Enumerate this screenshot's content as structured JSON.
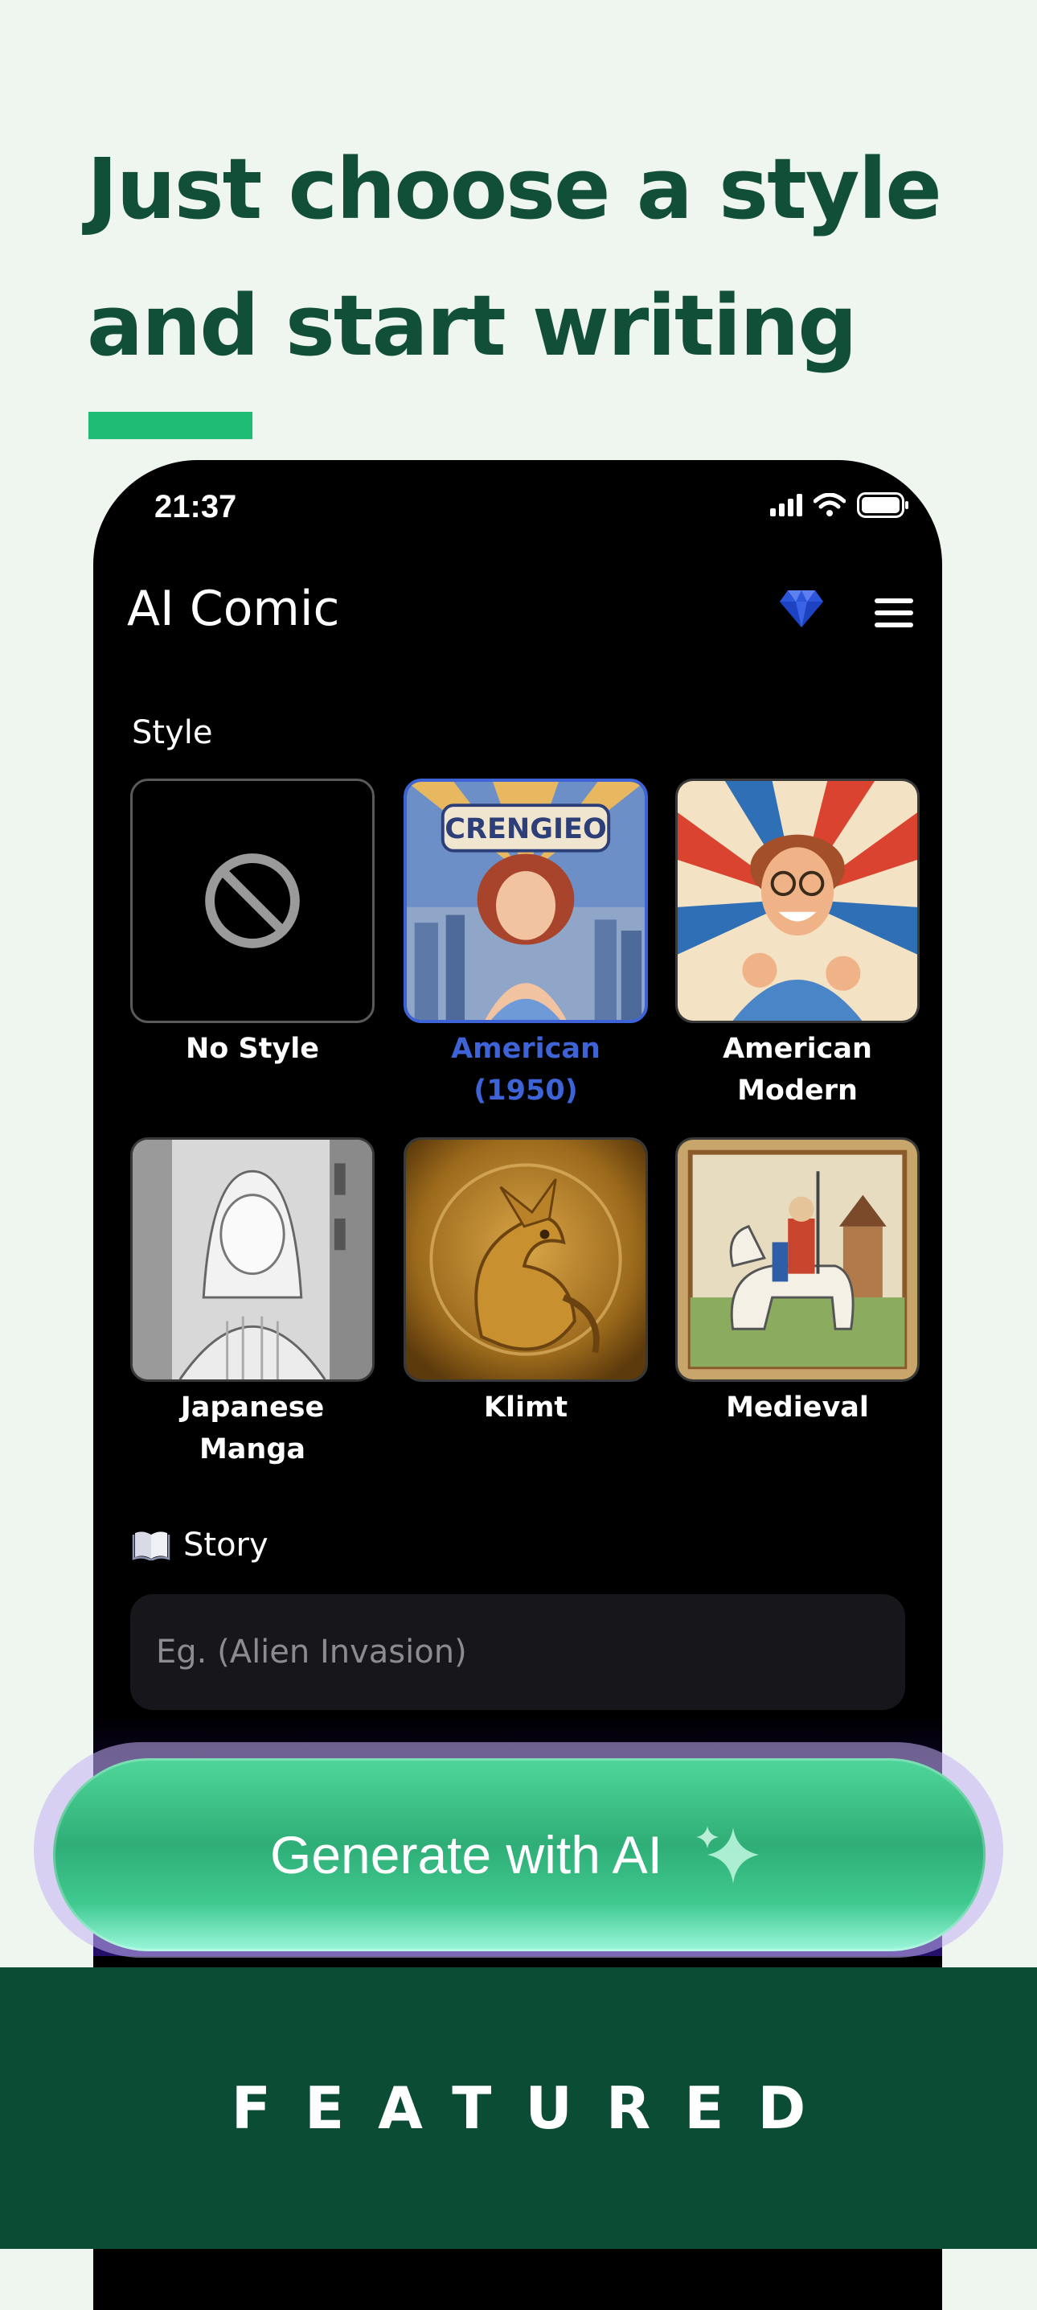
{
  "headline": {
    "line1": "Just choose a style",
    "line2": "and start writing"
  },
  "status_bar": {
    "time": "21:37",
    "icons": [
      "signal-icon",
      "wifi-icon",
      "battery-icon"
    ]
  },
  "app": {
    "title": "AI Comic",
    "premium_icon": "gem-icon",
    "menu_icon": "menu-icon"
  },
  "style_section": {
    "label": "Style",
    "styles": [
      {
        "line1": "No Style",
        "line2": "",
        "selected": false
      },
      {
        "line1": "American",
        "line2": "(1950)",
        "selected": true
      },
      {
        "line1": "American",
        "line2": "Modern",
        "selected": false
      },
      {
        "line1": "Japanese",
        "line2": "Manga",
        "selected": false
      },
      {
        "line1": "Klimt",
        "line2": "",
        "selected": false
      },
      {
        "line1": "Medieval",
        "line2": "",
        "selected": false
      }
    ],
    "thumb_text": "CRENGIEO"
  },
  "story_section": {
    "label": "Story",
    "icon": "book-icon",
    "placeholder": "Eg. (Alien Invasion)"
  },
  "generate_button": {
    "label": "Generate with AI",
    "icon": "sparkle-icon"
  },
  "footer": {
    "label": "FEATURED"
  },
  "colors": {
    "background": "#eff5ef",
    "headline": "#114f38",
    "accent": "#1fbc76",
    "selected_style": "#3d63d6",
    "footer": "#0b4d34"
  }
}
